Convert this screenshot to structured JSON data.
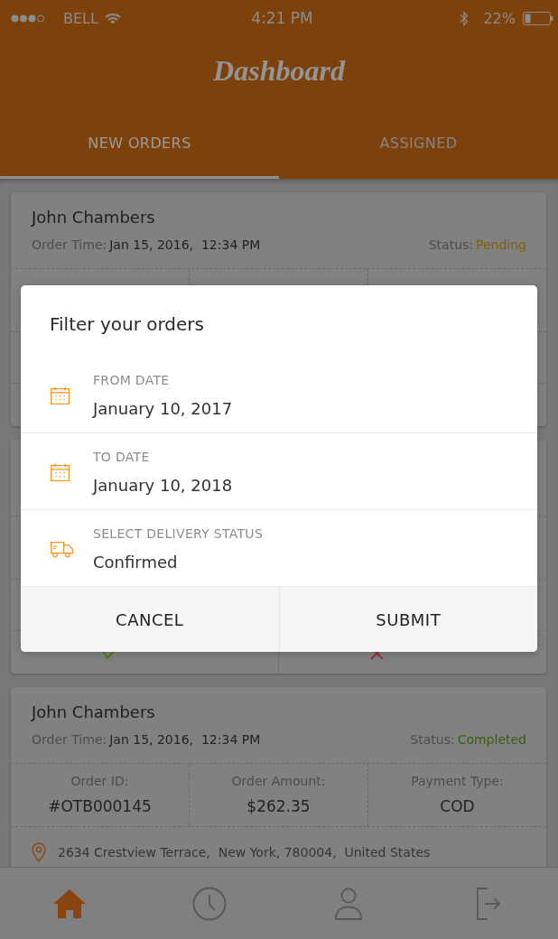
{
  "status_bar": {
    "carrier": "BELL",
    "time": "4:21 PM",
    "battery": "22%"
  },
  "header": {
    "title": "Dashboard"
  },
  "tabs": [
    {
      "label": "NEW ORDERS",
      "selected": true
    },
    {
      "label": "ASSIGNED",
      "selected": false
    }
  ],
  "orders": [
    {
      "customer": "John Chambers",
      "order_time_label": "Order Time:",
      "order_time": "Jan 15, 2016,  12:34 PM",
      "status_label": "Status:",
      "status": "Pending",
      "color": "#7f600c"
    },
    {
      "actions": [
        {
          "kind": "accept"
        },
        {
          "kind": "reject"
        }
      ]
    },
    {
      "customer": "John Chambers",
      "order_time_label": "Order Time:",
      "order_time": "Jan 15, 2016,  12:34 PM",
      "status_label": "Status:",
      "status": "Completed",
      "color": "#375f10",
      "details": [
        {
          "label": "Order ID:",
          "value": "#OTB000145"
        },
        {
          "label": "Order Amount:",
          "value": "$262.35"
        },
        {
          "label": "Payment Type:",
          "value": "COD"
        }
      ],
      "address": "2634 Crestview Terrace,  New York, 780004,  United States"
    }
  ],
  "bottom_nav": [
    {
      "selected": true
    },
    {
      "selected": false
    },
    {
      "selected": false
    },
    {
      "selected": false
    }
  ],
  "filter_dialog": {
    "title": "Filter your orders",
    "fields": [
      {
        "kind": "date",
        "label": "FROM DATE",
        "value": "January 10, 2017"
      },
      {
        "kind": "date",
        "label": "TO DATE",
        "value": "January 10, 2018"
      },
      {
        "kind": "delivery",
        "label": "SELECT DELIVERY STATUS",
        "value": "Confirmed"
      }
    ],
    "buttons": [
      {
        "label": "CANCEL"
      },
      {
        "label": "SUBMIT"
      }
    ]
  }
}
